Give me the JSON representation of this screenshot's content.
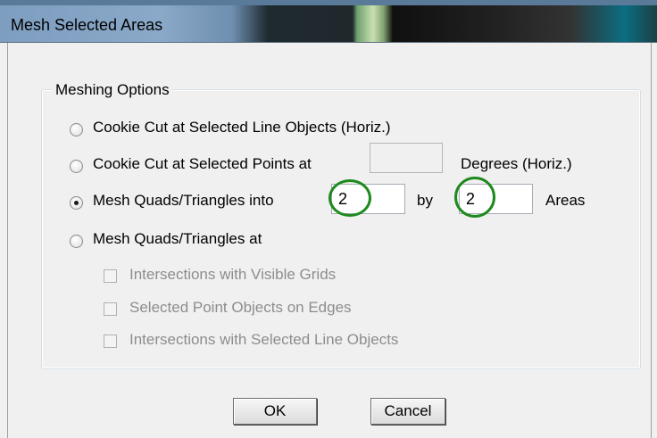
{
  "window": {
    "title": "Mesh Selected Areas"
  },
  "group": {
    "label": "Meshing Options"
  },
  "options": {
    "cookie_cut_lines": "Cookie Cut at Selected Line Objects (Horiz.)",
    "cookie_cut_points_prefix": "Cookie Cut at Selected Points at",
    "cookie_cut_points_suffix": "Degrees (Horiz.)",
    "cookie_cut_points_value": "",
    "mesh_into_prefix": "Mesh Quads/Triangles into",
    "mesh_into_value1": "2",
    "mesh_into_by": "by",
    "mesh_into_value2": "2",
    "mesh_into_suffix": "Areas",
    "mesh_at": "Mesh Quads/Triangles at",
    "selected_option": "mesh_into"
  },
  "suboptions": {
    "grids": "Intersections with Visible Grids",
    "edges": "Selected Point Objects on Edges",
    "lines": "Intersections with Selected Line Objects"
  },
  "buttons": {
    "ok": "OK",
    "cancel": "Cancel"
  },
  "colors": {
    "highlight_ring": "#1e8a1e",
    "disabled_text": "#8d8d8d"
  }
}
